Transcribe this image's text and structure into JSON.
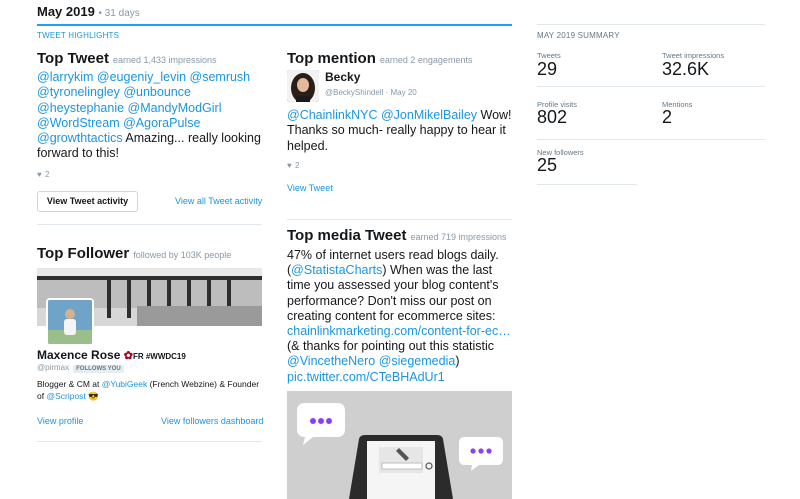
{
  "header": {
    "month": "May 2019",
    "days": "31 days"
  },
  "highlights": {
    "caption": "TWEET HIGHLIGHTS"
  },
  "top_tweet": {
    "title": "Top Tweet",
    "subtitle": "earned 1,433 impressions",
    "mentions": "@larrykim @eugeniy_levin @semrush @tyronelingley @unbounce @heystephanie @MandyModGirl @WordStream @AgoraPulse @growthtactics",
    "text": " Amazing... really looking forward to this!",
    "likes": "2",
    "view_activity_label": "View Tweet activity",
    "view_all_label": "View all Tweet activity"
  },
  "top_follower": {
    "title": "Top Follower",
    "subtitle": "followed by 103K people",
    "name": "Maxence Rose",
    "name_suffix": "FR #WWDC19",
    "handle": "@pirmax",
    "follows_you": "FOLLOWS YOU",
    "bio_prefix": "Blogger & CM at ",
    "bio_link1": "@YubiGeek",
    "bio_middle": " (French Webzine) & Founder of ",
    "bio_link2": "@Scripost",
    "bio_emoji": "😎",
    "view_profile_label": "View profile",
    "view_followers_label": "View followers dashboard"
  },
  "top_mention": {
    "title": "Top mention",
    "subtitle": "earned 2 engagements",
    "name": "Becky",
    "handle": "@BeckyShindell",
    "date": "May 20",
    "mentions": "@ChainlinkNYC @JonMikelBailey",
    "text": " Wow! Thanks so much- really happy to hear it helped.",
    "likes": "2",
    "view_tweet_label": "View Tweet"
  },
  "top_media": {
    "title": "Top media Tweet",
    "subtitle": "earned 719 impressions",
    "text1": "47% of internet users read blogs daily. (",
    "link1": "@StatistaCharts",
    "text2": ") When was the last time you assessed your blog content's performance? Don't miss our post on creating content for ecommerce sites: ",
    "link2": "chainlinkmarketing.com/content-for-ec…",
    "text3": " (& thanks for pointing out this statistic ",
    "link3": "@VincetheNero",
    "link4": "@siegemedia",
    "text4": ") ",
    "link5": "pic.twitter.com/CTeBHAdUr1"
  },
  "summary": {
    "caption": "MAY 2019 SUMMARY",
    "tweets_label": "Tweets",
    "tweets_value": "29",
    "impressions_label": "Tweet impressions",
    "impressions_value": "32.6K",
    "visits_label": "Profile visits",
    "visits_value": "802",
    "mentions_label": "Mentions",
    "mentions_value": "2",
    "followers_label": "New followers",
    "followers_value": "25"
  },
  "colors": {
    "accent": "#1da1f2",
    "link": "#1b95e0",
    "muted": "#8899a6"
  }
}
